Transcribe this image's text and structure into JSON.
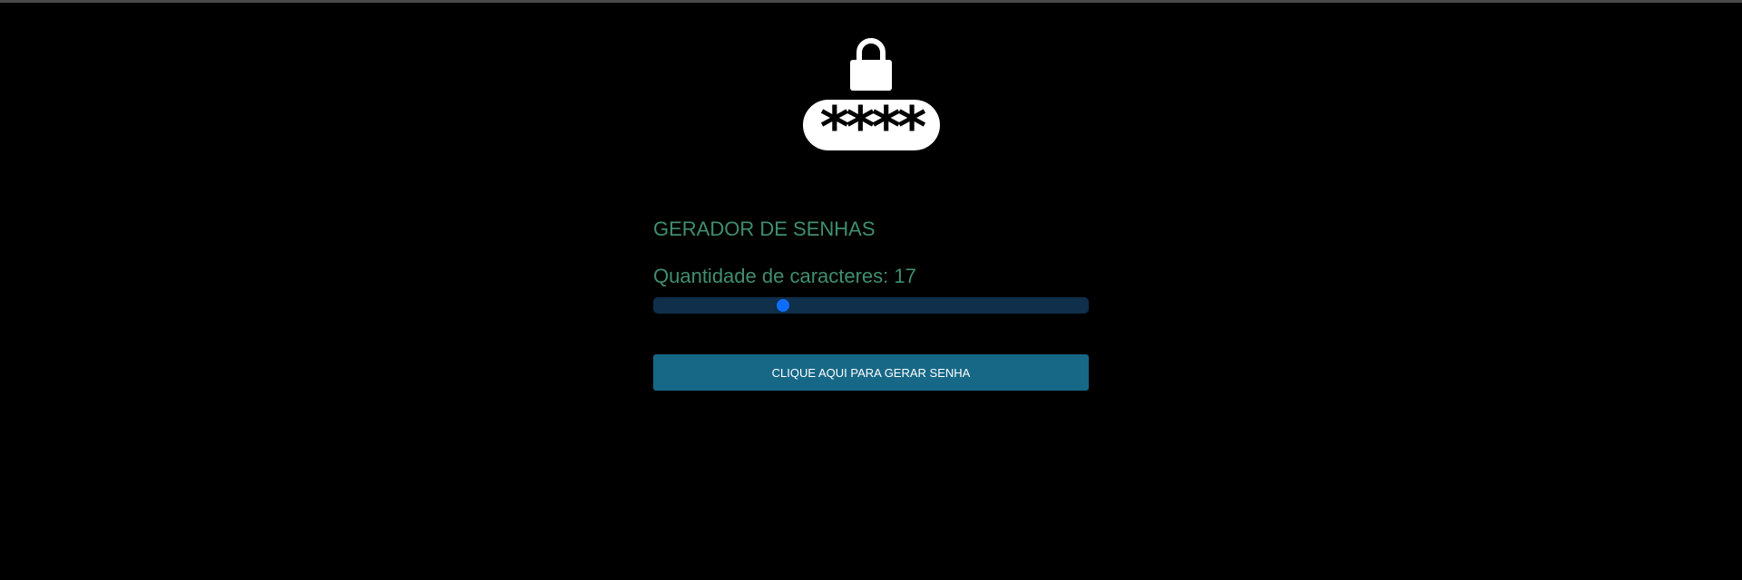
{
  "header": {
    "logo_icon": "lock-password-icon",
    "logo_text": "****"
  },
  "main": {
    "title": "GERADOR DE SENHAS",
    "quantity_label": "Quantidade de caracteres: 17",
    "slider": {
      "value": 17,
      "level_fraction": 0.29
    },
    "generate_button": "CLIQUE AQUI PARA GERAR SENHA"
  },
  "colors": {
    "background": "#000000",
    "text_accent": "#3f8f6e",
    "slider_track": "#0f2f4a",
    "slider_thumb": "#0d6efd",
    "button": "#176887"
  }
}
